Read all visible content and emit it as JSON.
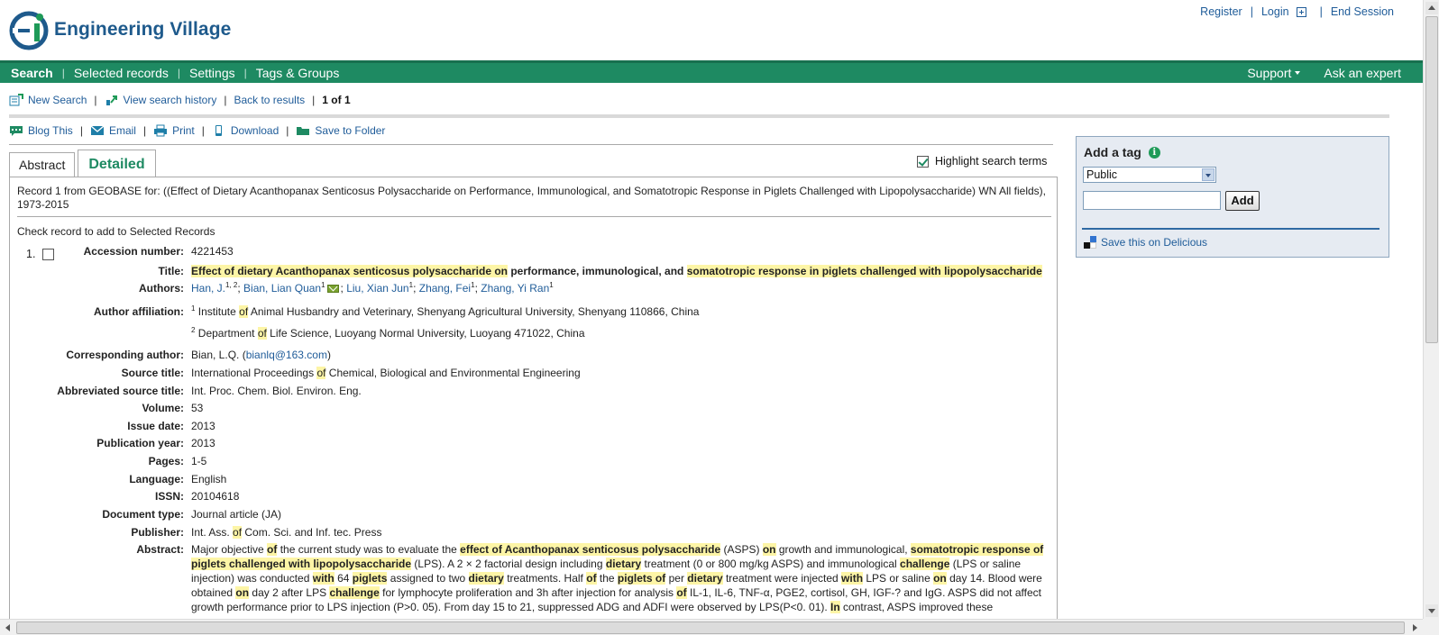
{
  "colors": {
    "brand_green": "#1e8a62",
    "link_blue": "#1f5c99",
    "highlight": "#fdf5a6",
    "sidebar_bg": "#e6ebf2"
  },
  "header": {
    "logo_text": "Engineering Village",
    "links": {
      "register": "Register",
      "login": "Login",
      "end_session": "End Session",
      "sep": "|"
    }
  },
  "nav": {
    "search": "Search",
    "selected_records": "Selected records",
    "settings": "Settings",
    "tags_groups": "Tags & Groups",
    "support": "Support",
    "ask_expert": "Ask an expert",
    "sep": "|"
  },
  "toolbar1": {
    "new_search": "New Search",
    "view_history": "View search history",
    "back_results": "Back to results",
    "record_count": "1 of 1",
    "sep": "|"
  },
  "toolbar2": {
    "blog": "Blog This",
    "email": "Email",
    "print": "Print",
    "download": "Download",
    "save_folder": "Save to Folder",
    "sep": "|"
  },
  "tabs": {
    "abstract": "Abstract",
    "detailed": "Detailed"
  },
  "highlight_label": "Highlight search terms",
  "record": {
    "header": "Record 1 from GEOBASE for: ((Effect of Dietary Acanthopanax Senticosus Polysaccharide on Performance, Immunological, and Somatotropic Response in Piglets Challenged with Lipopolysaccharide) WN All fields), 1973-2015",
    "check_hint": "Check record to add to Selected Records",
    "number": "1.",
    "labels": {
      "accession": "Accession number:",
      "title": "Title:",
      "authors": "Authors:",
      "affiliation": "Author affiliation:",
      "corresponding": "Corresponding author:",
      "source_title": "Source title:",
      "abbrev_source": "Abbreviated source title:",
      "volume": "Volume:",
      "issue_date": "Issue date:",
      "pub_year": "Publication year:",
      "pages": "Pages:",
      "language": "Language:",
      "issn": "ISSN:",
      "doc_type": "Document type:",
      "publisher": "Publisher:",
      "abstract": "Abstract:"
    },
    "accession": "4221453",
    "title_parts": {
      "t1": "Effect of dietary Acanthopanax senticosus polysaccharide on",
      "t2": " performance, immunological, and ",
      "t3": "somatotropic response in piglets challenged with lipopolysaccharide"
    },
    "authors": {
      "a1": "Han, J.",
      "a1_sup": "1, 2",
      "a2": "Bian, Lian Quan",
      "a2_sup": "1",
      "a3": "Liu, Xian Jun",
      "a3_sup": "1",
      "a4": "Zhang, Fei",
      "a4_sup": "1",
      "a5": "Zhang, Yi Ran",
      "a5_sup": "1",
      "sep": "; "
    },
    "affiliation": {
      "aff1_sup": "1",
      "aff1_a": " Institute ",
      "aff1_of": "of",
      "aff1_b": " Animal Husbandry and Veterinary, Shenyang Agricultural University, Shenyang 110866, China",
      "aff2_sup": "2",
      "aff2_a": " Department ",
      "aff2_of": "of",
      "aff2_b": " Life Science, Luoyang Normal University, Luoyang 471022, China"
    },
    "corresponding": {
      "name": "Bian, L.Q.",
      "open": " (",
      "email": "bianlq@163.com",
      "close": ")"
    },
    "source_title": {
      "a": "International Proceedings ",
      "of": "of",
      "b": " Chemical, Biological and Environmental Engineering"
    },
    "abbrev_source": "Int. Proc. Chem. Biol. Environ. Eng.",
    "volume": "53",
    "issue_date": "2013",
    "pub_year": "2013",
    "pages": "1-5",
    "language": "English",
    "issn": "20104618",
    "doc_type": "Journal article (JA)",
    "publisher": {
      "a": "Int. Ass. ",
      "of": "of",
      "b": " Com. Sci. and Inf. tec. Press"
    },
    "abstract": {
      "p01": "Major objective ",
      "p02": "of",
      "p03": " the current study was to evaluate the ",
      "p04": "effect of Acanthopanax senticosus polysaccharide",
      "p05": " (ASPS) ",
      "p06": "on",
      "p07": " growth and immunological, ",
      "p08": "somatotropic response of piglets challenged with lipopolysaccharide",
      "p09": " (LPS). A 2 × 2 factorial design including ",
      "p10": "dietary",
      "p11": " treatment (0 or 800 mg/kg ASPS) and immunological ",
      "p12": "challenge",
      "p13": " (LPS or saline injection) was conducted ",
      "p14": "with",
      "p15": " 64 ",
      "p16": "piglets",
      "p17": " assigned to two ",
      "p18": "dietary",
      "p19": " treatments. Half ",
      "p20": "of",
      "p21": " the ",
      "p22": "piglets of",
      "p23": " per ",
      "p24": "dietary",
      "p25": " treatment were injected ",
      "p26": "with",
      "p27": " LPS or saline ",
      "p28": "on",
      "p29": " day 14. Blood were obtained ",
      "p30": "on",
      "p31": " day 2 after LPS ",
      "p32": "challenge",
      "p33": " for lymphocyte proliferation and 3h after injection for analysis ",
      "p34": "of",
      "p35": " IL-1, IL-6, TNF-α, PGE2, cortisol, GH, IGF-? and IgG. ASPS did not affect growth performance prior to LPS injection (P>0. 05). From day 15 to 21, suppressed ADG and ADFI were observed by LPS(P<0. 01). ",
      "p36": "In",
      "p37": " contrast, ASPS improved these"
    }
  },
  "sidebar": {
    "title": "Add a tag",
    "info": "i",
    "select_value": "Public",
    "add_button": "Add",
    "delicious": "Save this on Delicious"
  }
}
